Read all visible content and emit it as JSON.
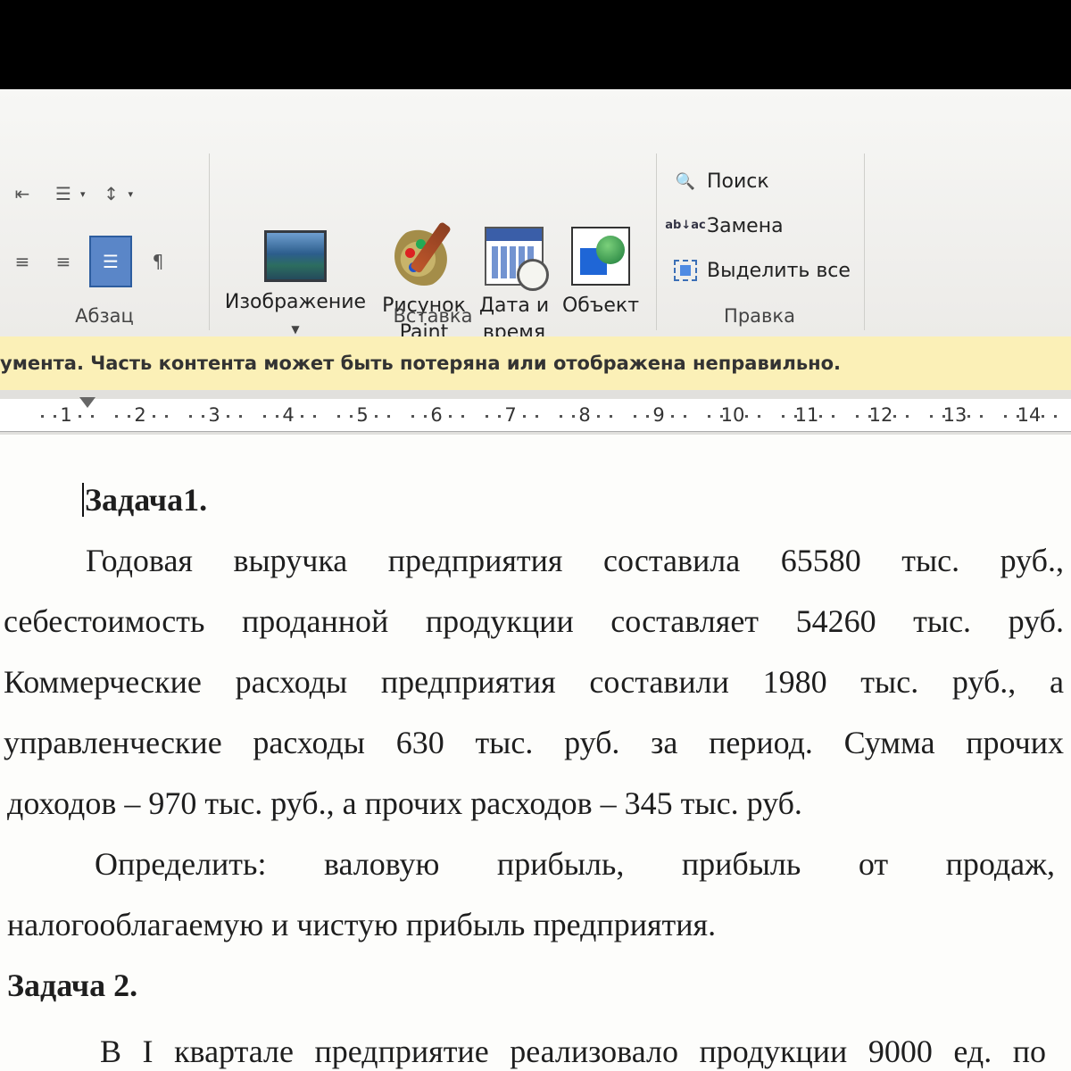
{
  "ribbon": {
    "paragraph_group": {
      "label": "Абзац"
    },
    "insert_group": {
      "label": "Вставка",
      "buttons": [
        {
          "label_line1": "Изображение",
          "label_line2": ""
        },
        {
          "label_line1": "Рисунок",
          "label_line2": "Paint"
        },
        {
          "label_line1": "Дата и",
          "label_line2": "время"
        },
        {
          "label_line1": "Объект",
          "label_line2": ""
        }
      ]
    },
    "editing_group": {
      "label": "Правка",
      "find": "Поиск",
      "replace": "Замена",
      "replace_icon_text": "ab↓ac",
      "select_all": "Выделить все"
    }
  },
  "warning_bar": {
    "text": "умента. Часть контента может быть потеряна или отображена неправильно."
  },
  "ruler": {
    "marks": [
      "1",
      "2",
      "3",
      "4",
      "5",
      "6",
      "7",
      "8",
      "9",
      "10",
      "11",
      "12",
      "13",
      "14"
    ]
  },
  "document": {
    "task1_title": "Задача1.",
    "p1": [
      "Годовая выручка предприятия составила 65580 тыс. руб.,",
      "себестоимость проданной продукции составляет 54260 тыс. руб.",
      "Коммерческие расходы предприятия составили 1980 тыс. руб., а",
      "управленческие расходы 630 тыс. руб. за период. Сумма прочих",
      "доходов – 970 тыс. руб., а прочих расходов – 345 тыс. руб."
    ],
    "p2": [
      "Определить: валовую прибыль, прибыль от продаж,",
      "налогооблагаемую и чистую прибыль предприятия."
    ],
    "task2_title": "Задача 2.",
    "task2_partial": "В I квартале предприятие реализовало продукции 9000 ед. по"
  }
}
